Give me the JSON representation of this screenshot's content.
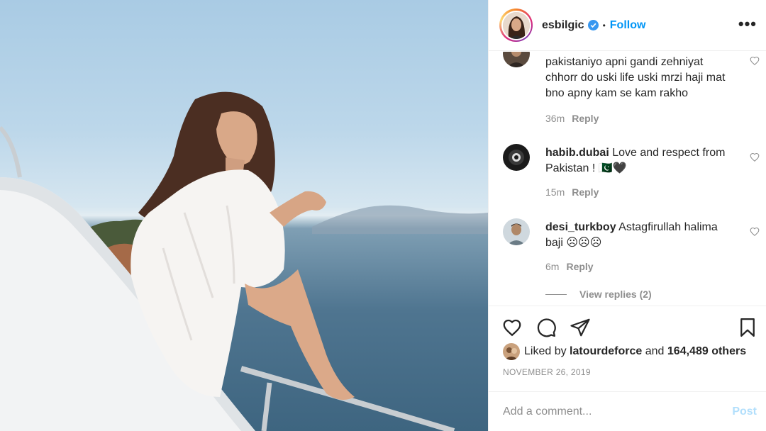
{
  "post": {
    "image_icon": "photo-woman-on-yacht"
  },
  "header": {
    "username": "esbilgic",
    "dot": "•",
    "follow_label": "Follow",
    "more_icon": "more-horizontal-icon",
    "more_label": "•••"
  },
  "comments": [
    {
      "username": "",
      "text": "pakistaniyo apni gandi zehniyat chhorr do uski life uski mrzi haji mat bno apny kam se kam rakho",
      "time": "36m",
      "reply_label": "Reply"
    },
    {
      "username": "habib.dubai",
      "text": "Love and respect from Pakistan ! 🇵🇰🖤",
      "time": "15m",
      "reply_label": "Reply"
    },
    {
      "username": "desi_turkboy",
      "text": "Astagfirullah halima baji ☹☹☹",
      "time": "6m",
      "reply_label": "Reply"
    }
  ],
  "view_replies_label": "View replies (2)",
  "actions": {
    "like_icon": "heart-icon",
    "comment_icon": "comment-bubble-icon",
    "share_icon": "paper-plane-icon",
    "save_icon": "bookmark-icon"
  },
  "likes": {
    "prefix": "Liked by",
    "user": "latourdeforce",
    "middle": "and",
    "count": "164,489 others"
  },
  "date": "NOVEMBER 26, 2019",
  "add_comment": {
    "placeholder": "Add a comment...",
    "post_label": "Post"
  },
  "colors": {
    "link_blue": "#0095f6",
    "post_disabled": "#b2dffc",
    "muted": "#8e8e8e",
    "text": "#262626"
  }
}
